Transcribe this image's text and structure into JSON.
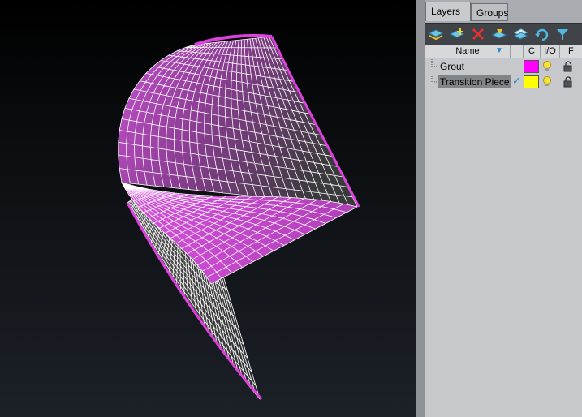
{
  "tabs": [
    {
      "label": "Layers",
      "active": true
    },
    {
      "label": "Groups",
      "active": false
    }
  ],
  "toolbar": {
    "icons": [
      "new-layer-icon",
      "add-layer-icon",
      "delete-layer-icon",
      "layer-properties-icon",
      "copy-layer-icon",
      "undo-icon",
      "filter-icon"
    ]
  },
  "columns": {
    "name": "Name",
    "color": "C",
    "io": "I/O",
    "freeze": "F"
  },
  "layers": [
    {
      "name": "Grout",
      "color": "#ff00ff",
      "current": false,
      "selected": false
    },
    {
      "name": "Transition Piece",
      "color": "#ffff00",
      "current": true,
      "selected": true
    }
  ],
  "colors": {
    "mesh": "#e040e0",
    "viewport_top": "#000000",
    "viewport_bottom": "#1c2128",
    "panel": "#a9acb0"
  }
}
